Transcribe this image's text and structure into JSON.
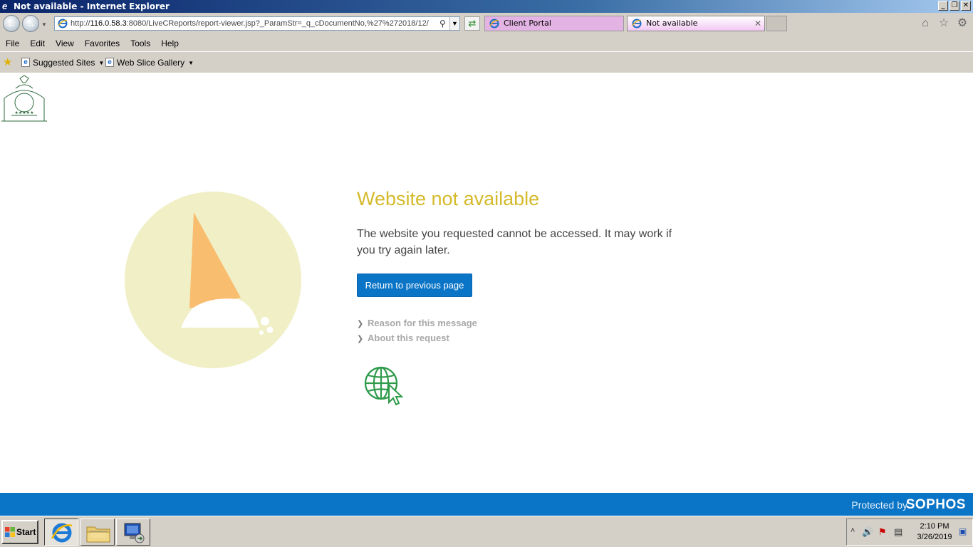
{
  "window": {
    "title": "Not available - Internet Explorer",
    "controls": {
      "minimize": "_",
      "restore": "❐",
      "close": "✕"
    }
  },
  "nav": {
    "back_icon": "back-arrow-icon",
    "forward_icon": "forward-arrow-icon",
    "address": {
      "prefix": "http://",
      "host": "116.0.58.3",
      "rest": ":8080/LiveCReports/report-viewer.jsp?_ParamStr=_q_cDocumentNo,%27%272018/12/"
    },
    "tabs": [
      {
        "label": "Client Portal"
      },
      {
        "label": "Not available",
        "close": "✕"
      }
    ]
  },
  "menu": [
    "File",
    "Edit",
    "View",
    "Favorites",
    "Tools",
    "Help"
  ],
  "favorites": {
    "items": [
      {
        "label": "Suggested Sites"
      },
      {
        "label": "Web Slice Gallery"
      }
    ]
  },
  "page": {
    "heading": "Website not available",
    "message": "The website you requested cannot be accessed. It may work if you try again later.",
    "button": "Return to previous page",
    "links": [
      "Reason for this message",
      "About this request"
    ],
    "colors": {
      "heading": "#d4ba2c",
      "button": "#0a74c6",
      "circle": "#f0efc6",
      "sail": "#f9bd6f"
    }
  },
  "footer": {
    "protected_by": "Protected by",
    "brand": "SOPHOS"
  },
  "taskbar": {
    "start": "Start",
    "time": "2:10 PM",
    "date": "3/26/2019"
  }
}
